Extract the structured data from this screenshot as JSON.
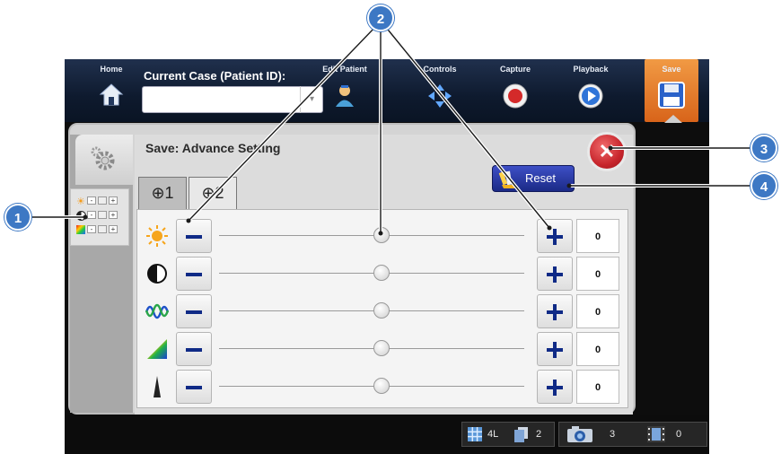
{
  "nav": {
    "items": [
      {
        "label": "Home",
        "icon": "home-icon"
      },
      {
        "label": "Edit Patient",
        "icon": "patient-icon"
      },
      {
        "label": "Controls",
        "icon": "arrows-icon"
      },
      {
        "label": "Capture",
        "icon": "record-icon"
      },
      {
        "label": "Playback",
        "icon": "play-icon"
      },
      {
        "label": "Save",
        "icon": "floppy-disk-icon",
        "active": true
      }
    ],
    "case_label": "Current Case (Patient ID):",
    "case_value": ""
  },
  "panel": {
    "title": "Save: Advance Setting",
    "reset_label": "Reset",
    "tabs": [
      "⊕1",
      "⊕2"
    ]
  },
  "adjustments": [
    {
      "name": "brightness",
      "icon": "sun-icon",
      "value": "0"
    },
    {
      "name": "contrast",
      "icon": "contrast-icon",
      "value": "0"
    },
    {
      "name": "hue",
      "icon": "wave-icon",
      "value": "0"
    },
    {
      "name": "saturation",
      "icon": "color-spectrum-icon",
      "value": "0"
    },
    {
      "name": "sharpness",
      "icon": "triangle-icon",
      "value": "0"
    }
  ],
  "mini_tab": {
    "minus": "-",
    "plus": "+"
  },
  "status": {
    "layout": "4L",
    "copies": "2",
    "photos": "3",
    "videos": "0"
  },
  "callouts": [
    "1",
    "2",
    "3",
    "4"
  ],
  "colors": {
    "accent": "#3d78c4",
    "save_orange": "#e27b2c",
    "reset_blue": "#2436a6",
    "close_red": "#c8262d"
  }
}
